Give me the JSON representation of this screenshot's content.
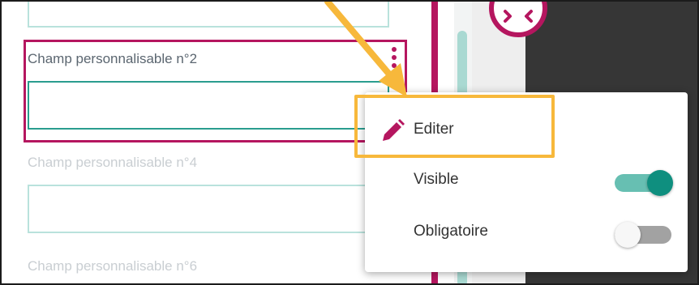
{
  "form": {
    "fields": [
      {
        "label": "",
        "state": "normal"
      },
      {
        "label": "Champ personnalisable n°2",
        "state": "selected"
      },
      {
        "label": "Champ personnalisable n°4",
        "state": "faded"
      },
      {
        "label": "Champ personnalisable n°6",
        "state": "faded"
      }
    ]
  },
  "context_menu": {
    "edit": {
      "label": "Editer",
      "icon": "pencil-icon"
    },
    "visible": {
      "label": "Visible",
      "checked": true
    },
    "required": {
      "label": "Obligatoire",
      "checked": false
    }
  },
  "colors": {
    "accent_pink": "#b5165f",
    "teal": "#2a9d8f",
    "highlight_orange": "#f7b83b"
  },
  "icons": [
    "move-icon",
    "kebab-menu-icon",
    "pencil-icon",
    "arrow-annotation-icon"
  ]
}
